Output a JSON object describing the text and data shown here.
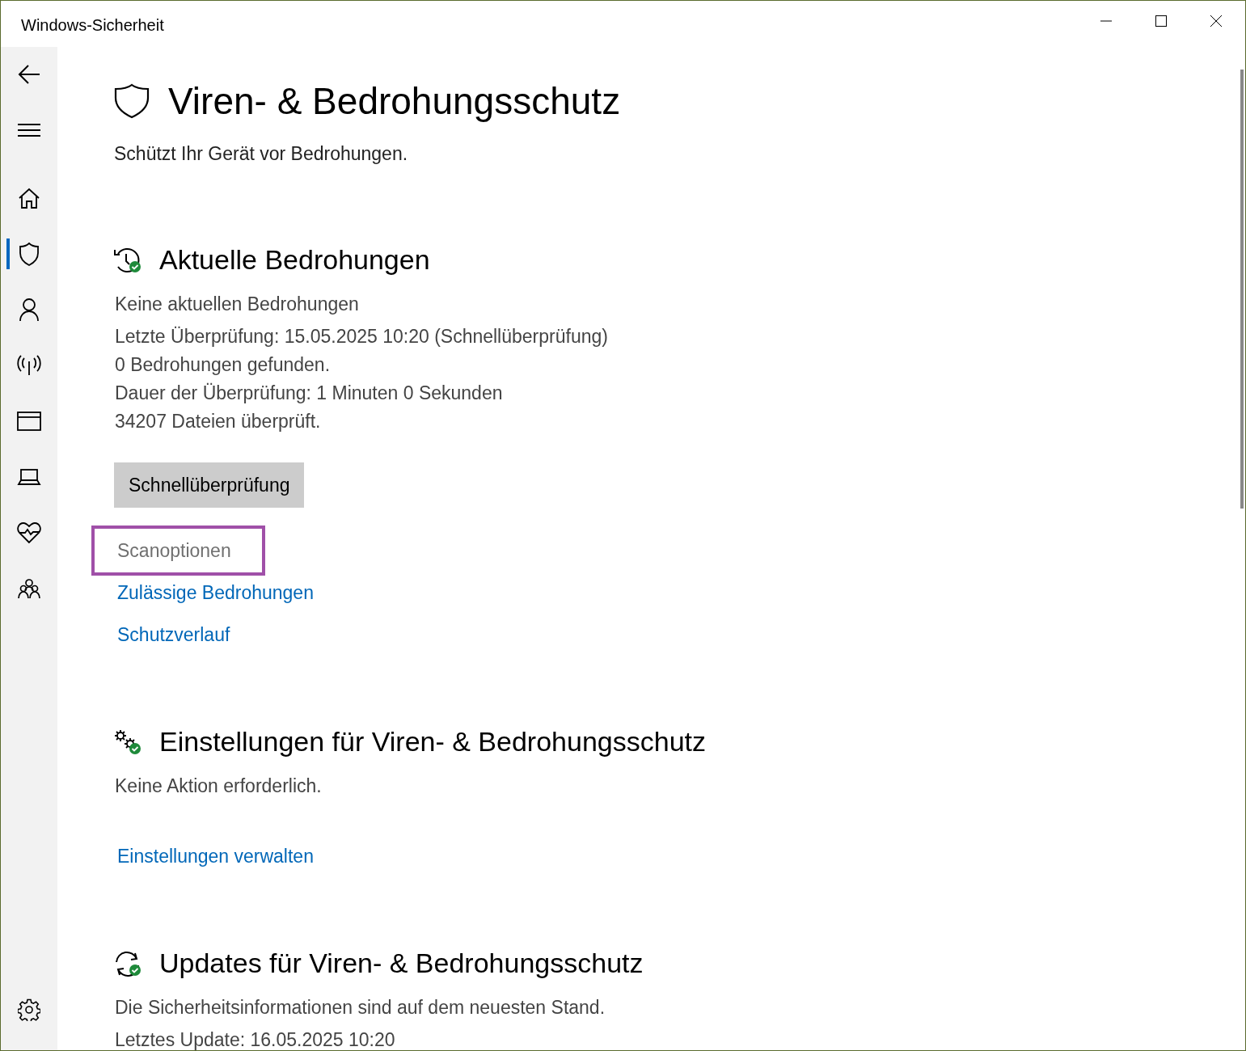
{
  "window": {
    "title": "Windows-Sicherheit"
  },
  "sidebar": {
    "items": [
      {
        "kind": "back",
        "selected": false
      },
      {
        "kind": "menu",
        "selected": false
      },
      {
        "kind": "home",
        "selected": false
      },
      {
        "kind": "shield",
        "selected": true
      },
      {
        "kind": "account",
        "selected": false
      },
      {
        "kind": "network",
        "selected": false
      },
      {
        "kind": "app",
        "selected": false
      },
      {
        "kind": "device",
        "selected": false
      },
      {
        "kind": "health",
        "selected": false
      },
      {
        "kind": "family",
        "selected": false
      }
    ],
    "footer": {
      "kind": "settings"
    }
  },
  "page": {
    "title": "Viren- & Bedrohungsschutz",
    "subtitle": "Schützt Ihr Gerät vor Bedrohungen."
  },
  "sections": [
    {
      "kind": "history",
      "title": "Aktuelle Bedrohungen",
      "lines": [
        "Keine aktuellen Bedrohungen",
        "Letzte Überprüfung: 15.05.2025 10:20 (Schnellüberprüfung)",
        "0 Bedrohungen gefunden.",
        "Dauer der Überprüfung: 1 Minuten 0 Sekunden",
        "34207 Dateien überprüft."
      ],
      "button": "Schnellüberprüfung",
      "links": [
        {
          "label": "Scanoptionen",
          "highlighted": true
        },
        {
          "label": "Zulässige Bedrohungen",
          "highlighted": false
        },
        {
          "label": "Schutzverlauf",
          "highlighted": false
        }
      ]
    },
    {
      "kind": "gears",
      "title": "Einstellungen für Viren- & Bedrohungsschutz",
      "lines": [
        "Keine Aktion erforderlich."
      ],
      "links": [
        {
          "label": "Einstellungen verwalten",
          "highlighted": false
        }
      ]
    },
    {
      "kind": "sync",
      "title": "Updates für Viren- & Bedrohungsschutz",
      "lines": [
        "Die Sicherheitsinformationen sind auf dem neuesten Stand.",
        "Letztes Update: 16.05.2025 10:20"
      ]
    }
  ]
}
